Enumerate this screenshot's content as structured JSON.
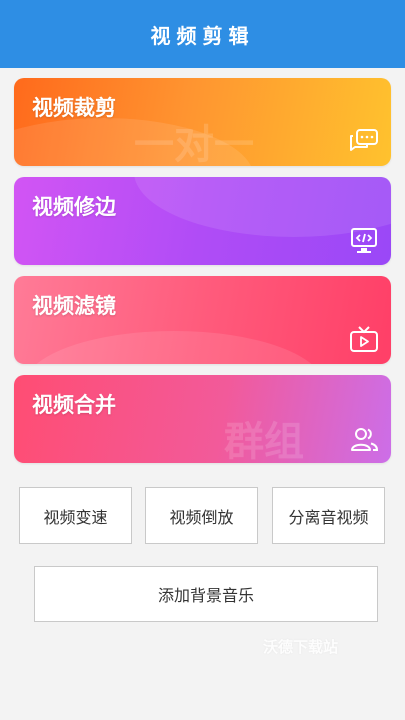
{
  "header": {
    "title": "视频剪辑"
  },
  "cards": [
    {
      "label": "视频裁剪",
      "icon": "chat-bubbles-icon",
      "watermark": "一对一"
    },
    {
      "label": "视频修边",
      "icon": "monitor-code-icon"
    },
    {
      "label": "视频滤镜",
      "icon": "tv-play-icon"
    },
    {
      "label": "视频合并",
      "icon": "users-icon",
      "watermark": "群组"
    }
  ],
  "buttons": {
    "speed": "视频变速",
    "reverse": "视频倒放",
    "extract_audio": "分离音视频",
    "add_music": "添加背景音乐"
  },
  "site_watermark": "沃德下载站",
  "colors": {
    "header": "#2e8ee4",
    "card1": "#ff8a26",
    "card2": "#b04cf6",
    "card3": "#ff5b7c",
    "card4": "#f25a9a"
  }
}
